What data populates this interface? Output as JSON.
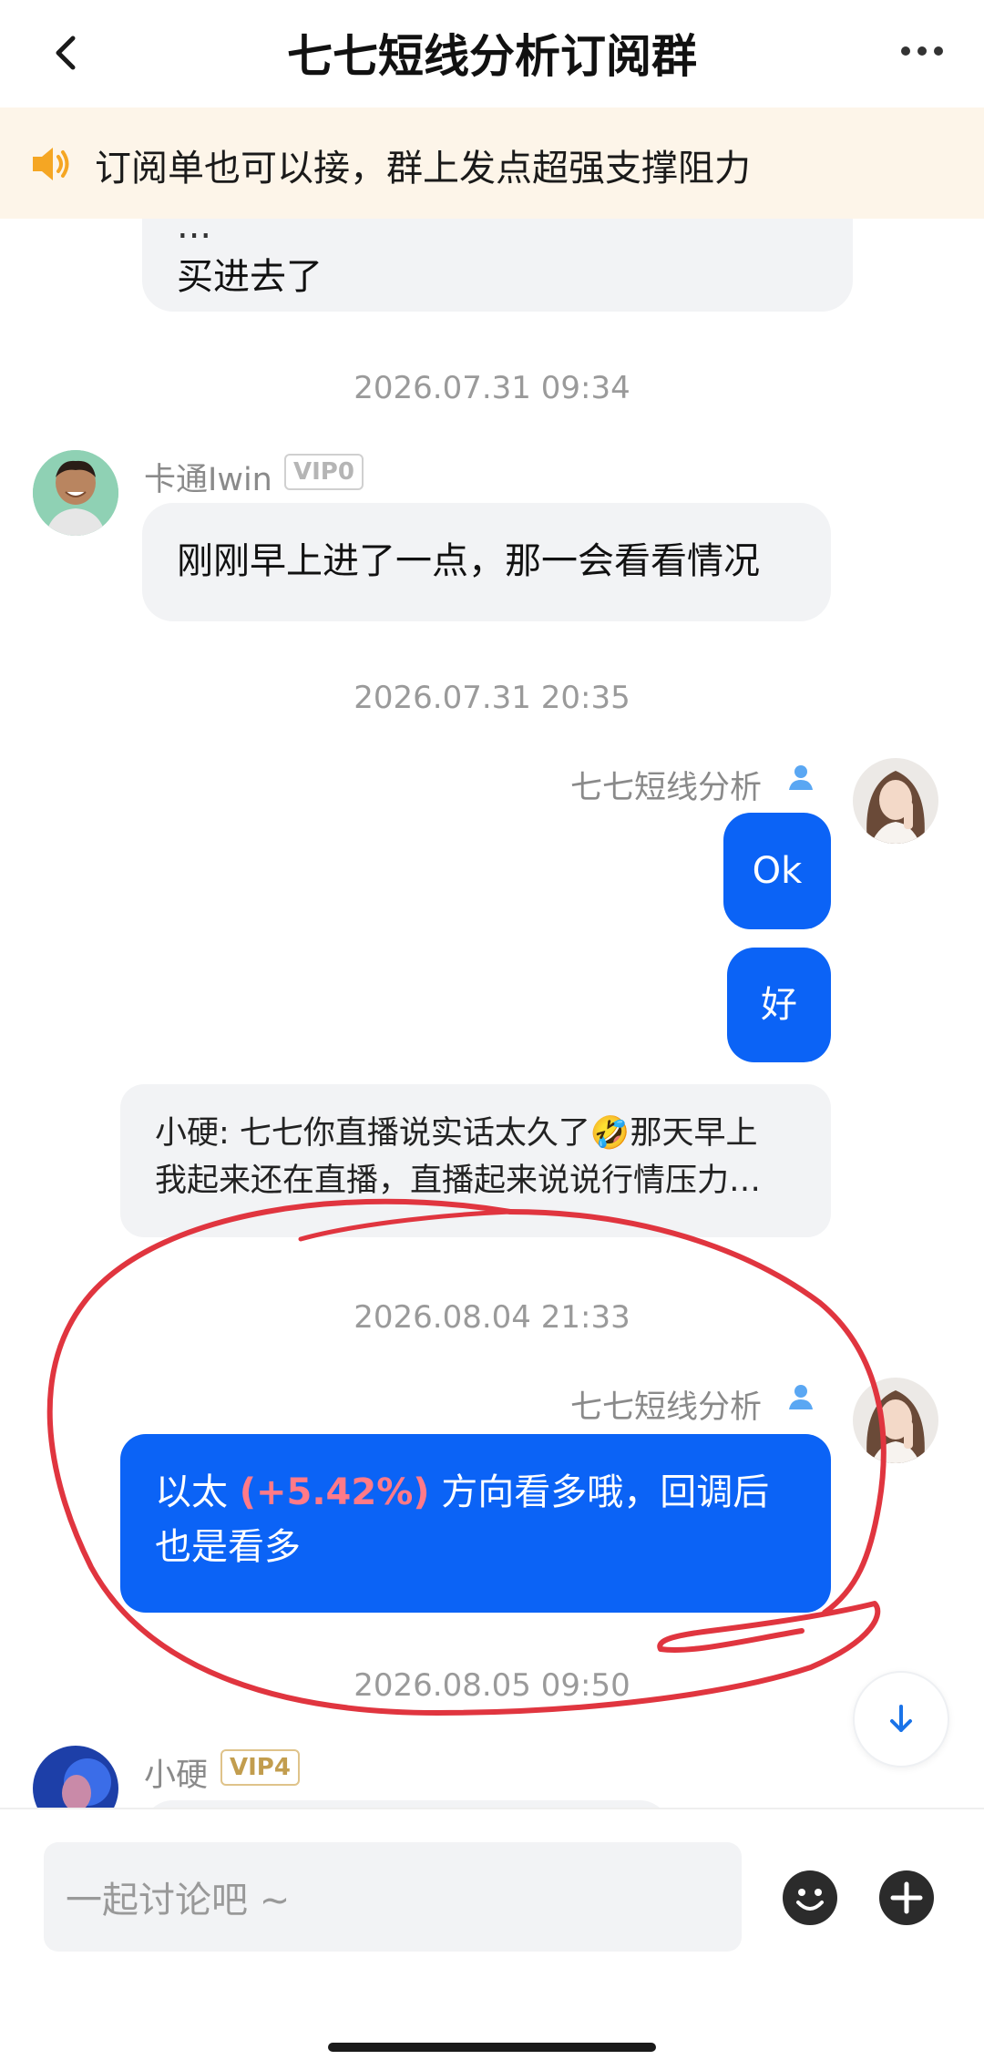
{
  "header": {
    "title": "七七短线分析订阅群"
  },
  "notice": {
    "text": "订阅单也可以接，群上发点超强支撑阻力"
  },
  "messages": {
    "cut_top": {
      "line1": "...",
      "line2": "买进去了"
    },
    "time1": "2026.07.31 09:34",
    "m1": {
      "sender": "卡通Iwin",
      "badge": "VIP0",
      "text": "刚刚早上进了一点，那一会看看情况"
    },
    "time2": "2026.07.31 20:35",
    "m2": {
      "sender": "七七短线分析",
      "bubble1": "Ok",
      "bubble2": "好"
    },
    "quote": {
      "line1": "小硬: 七七你直播说实话太久了🤣那天早上",
      "line2": "我起来还在直播，直播起来说说行情压力…"
    },
    "time3": "2026.08.04 21:33",
    "m3": {
      "sender": "七七短线分析",
      "prefix": "以太 ",
      "pct": "(+5.42%)",
      "suffix": " 方向看多哦，回调后",
      "line2": "也是看多"
    },
    "time4": "2026.08.05 09:50",
    "m4": {
      "sender": "小硬",
      "badge": "VIP4"
    }
  },
  "composer": {
    "placeholder": "一起讨论吧 ~"
  },
  "colors": {
    "accent_blue": "#0b63f6",
    "annotation_red": "#e0353f",
    "pct_pink": "#ff7a88",
    "notice_bg": "#fdf5e9"
  }
}
